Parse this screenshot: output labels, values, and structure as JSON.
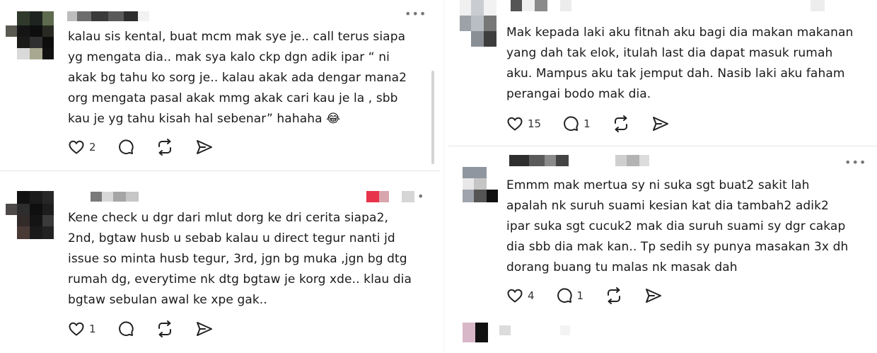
{
  "left_panel": {
    "posts": [
      {
        "text": "kalau sis kental, buat mcm mak sye je.. call terus siapa\nyg mengata dia.. mak sya kalo ckp dgn adik ipar “ ni\nakak bg tahu ko sorg je.. kalau akak ada dengar mana2\norg mengata pasal akak mmg akak cari kau je la , sbb\nkau je yg tahu kisah hal sebenar” hahaha 😂",
        "likes": "2",
        "replies": "",
        "more": "•••"
      },
      {
        "text": "Kene check u dgr dari mlut dorg ke dri cerita siapa2,\n2nd, bgtaw husb u sebab kalau u direct tegur nanti jd\nissue so minta husb tegur, 3rd, jgn bg muka ,jgn bg dtg\nrumah dg, everytime nk dtg bgtaw je korg xde.. klau dia\nbgtaw sebulan awal ke xpe gak..",
        "likes": "1",
        "replies": "",
        "more": "•"
      }
    ]
  },
  "right_panel": {
    "posts": [
      {
        "text": "Mak kepada laki aku fitnah aku bagi dia makan makanan\nyang dah tak elok, itulah last dia dapat masuk rumah\naku. Mampus aku tak jemput dah. Nasib laki aku faham\nperangai bodo mak dia.",
        "likes": "15",
        "replies": "1",
        "more": ""
      },
      {
        "text": "Emmm mak mertua sy ni suka sgt buat2 sakit lah\napalah nk suruh suami kesian kat dia tambah2 adik2\nipar suka sgt cucuk2 mak dia suruh suami sy dgr cakap\ndia sbb dia mak kan.. Tp sedih sy punya masakan 3x dh\ndorang buang tu malas nk masak dah",
        "likes": "4",
        "replies": "1",
        "more": "•••"
      }
    ]
  },
  "icons": {
    "like": "heart-icon",
    "reply": "comment-icon",
    "repost": "repost-icon",
    "share": "send-icon"
  },
  "colors": {
    "text": "#1a1a1a",
    "icon": "#222222",
    "divider": "#e6e6e6",
    "redacted_red": "#e8344a"
  }
}
